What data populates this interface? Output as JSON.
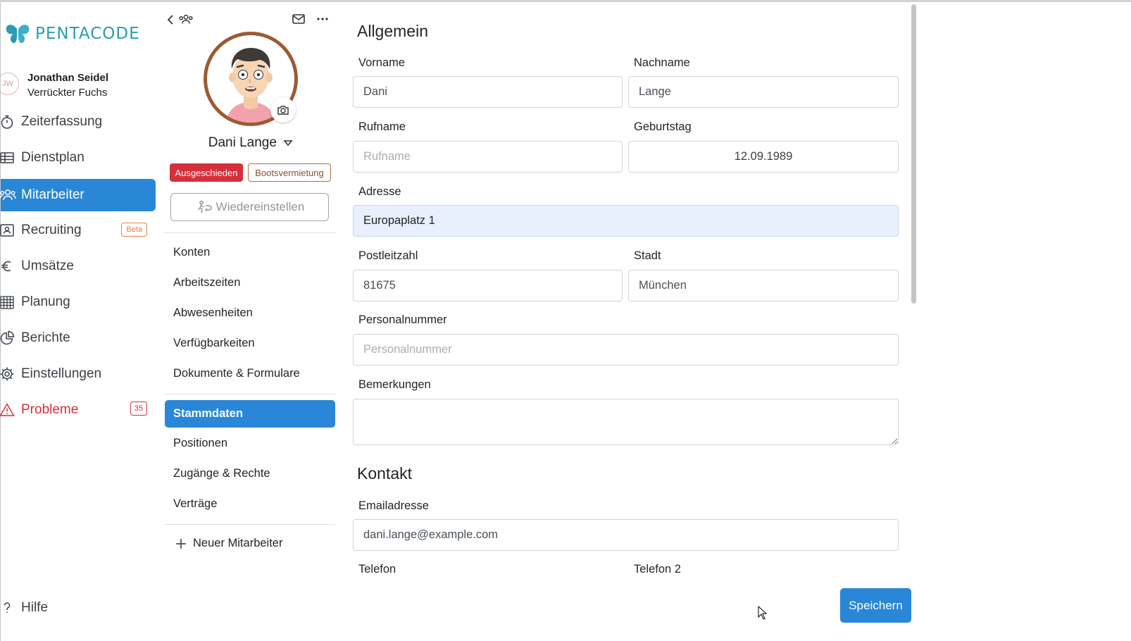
{
  "brand": {
    "name": "PENTACODE",
    "color": "#2a9bb3"
  },
  "user": {
    "initials": "JW",
    "name": "Jonathan Seidel",
    "team": "Verrückter Fuchs"
  },
  "nav": [
    {
      "label": "Zeiterfassung",
      "icon": "stopwatch-icon"
    },
    {
      "label": "Dienstplan",
      "icon": "table-icon"
    },
    {
      "label": "Mitarbeiter",
      "icon": "people-icon",
      "active": true
    },
    {
      "label": "Recruiting",
      "icon": "id-card-icon",
      "badge": "Beta"
    },
    {
      "label": "Umsätze",
      "icon": "euro-icon"
    },
    {
      "label": "Planung",
      "icon": "calendar-grid-icon"
    },
    {
      "label": "Berichte",
      "icon": "pie-chart-icon"
    },
    {
      "label": "Einstellungen",
      "icon": "gear-icon"
    },
    {
      "label": "Probleme",
      "icon": "warning-icon",
      "badge": "35"
    }
  ],
  "help": {
    "label": "Hilfe"
  },
  "employee": {
    "name": "Dani Lange",
    "tags": [
      "Ausgeschieden",
      "Bootsvermietung"
    ],
    "rehire_label": "Wiedereinstellen"
  },
  "profile_menu": {
    "group1": [
      "Konten",
      "Arbeitszeiten",
      "Abwesenheiten",
      "Verfügbarkeiten",
      "Dokumente & Formulare"
    ],
    "group2": [
      "Stammdaten",
      "Positionen",
      "Zugänge & Rechte",
      "Verträge"
    ],
    "active": "Stammdaten",
    "new_employee": "Neuer Mitarbeiter"
  },
  "form": {
    "general_title": "Allgemein",
    "vorname": {
      "label": "Vorname",
      "value": "Dani"
    },
    "nachname": {
      "label": "Nachname",
      "value": "Lange"
    },
    "rufname": {
      "label": "Rufname",
      "value": "",
      "placeholder": "Rufname"
    },
    "geburtstag": {
      "label": "Geburtstag",
      "value": "12.09.1989"
    },
    "adresse": {
      "label": "Adresse",
      "value": "Europaplatz 1"
    },
    "plz": {
      "label": "Postleitzahl",
      "value": "81675"
    },
    "stadt": {
      "label": "Stadt",
      "value": "München"
    },
    "personalnummer": {
      "label": "Personalnummer",
      "value": "",
      "placeholder": "Personalnummer"
    },
    "bemerkungen": {
      "label": "Bemerkungen",
      "value": ""
    },
    "contact_title": "Kontakt",
    "email": {
      "label": "Emailadresse",
      "value": "dani.lange@example.com"
    },
    "telefon": {
      "label": "Telefon"
    },
    "telefon2": {
      "label": "Telefon 2"
    }
  },
  "save_label": "Speichern",
  "colors": {
    "accent": "#2a86d6",
    "danger": "#d62f3a",
    "beta": "#e5814c"
  }
}
